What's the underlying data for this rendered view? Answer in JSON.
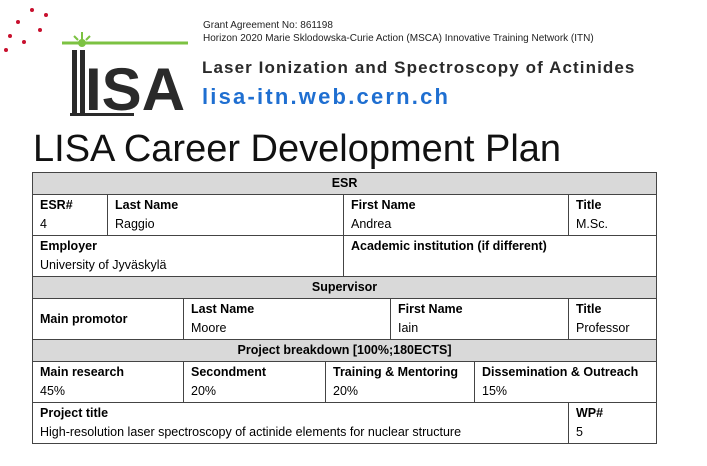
{
  "header": {
    "grant_line": "Grant Agreement No: 861198",
    "program_line": "Horizon 2020 Marie Sklodowska-Curie Action (MSCA) Innovative Training Network (ITN)",
    "org_name": "Laser Ionization and Spectroscopy of Actinides",
    "url": "lisa-itn.web.cern.ch",
    "logo_text": "LISA"
  },
  "page_title": "LISA Career Development Plan",
  "table": {
    "esr_section": "ESR",
    "esr_num_label": "ESR#",
    "esr_num": "4",
    "last_name_label": "Last Name",
    "last_name": "Raggio",
    "first_name_label": "First Name",
    "first_name": "Andrea",
    "title_label": "Title",
    "title": "M.Sc.",
    "employer_label": "Employer",
    "employer": "University of Jyväskylä",
    "academic_label": "Academic institution (if different)",
    "academic": "",
    "supervisor_section": "Supervisor",
    "main_promotor_label": "Main promotor",
    "sup_last_name_label": "Last Name",
    "sup_last_name": "Moore",
    "sup_first_name_label": "First Name",
    "sup_first_name": "Iain",
    "sup_title_label": "Title",
    "sup_title": "Professor",
    "breakdown_section": "Project breakdown [100%;180ECTS]",
    "main_research_label": "Main research",
    "main_research": "45%",
    "secondment_label": "Secondment",
    "secondment": "20%",
    "training_label": "Training & Mentoring",
    "training": "20%",
    "dissemination_label": "Dissemination & Outreach",
    "dissemination": "15%",
    "project_title_label": "Project title",
    "project_title": "High-resolution laser spectroscopy of actinide elements for nuclear structure",
    "wp_label": "WP#",
    "wp": "5"
  },
  "colors": {
    "accent_dots": "#c8102e",
    "url_blue": "#1f6fd1",
    "section_gray": "#d9d9d9",
    "logo_green": "#7cc242"
  }
}
